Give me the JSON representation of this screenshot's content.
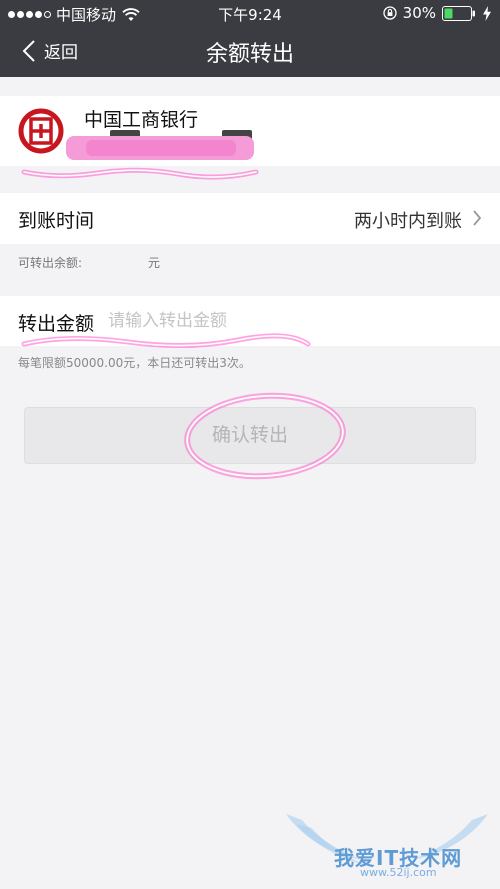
{
  "status_bar": {
    "carrier": "中国移动",
    "time": "下午9:24",
    "battery": "30%",
    "icons": [
      "signal-dots",
      "wifi-icon",
      "orientation-lock-icon",
      "battery-icon",
      "charging-icon"
    ]
  },
  "nav": {
    "back_label": "返回",
    "title": "余额转出"
  },
  "bank": {
    "name": "中国工商银行",
    "logo": "icbc-logo-icon"
  },
  "arrival": {
    "label": "到账时间",
    "value": "两小时内到账"
  },
  "balance": {
    "label": "可转出余额:",
    "unit": "元"
  },
  "amount": {
    "label": "转出金额",
    "placeholder": "请输入转出金额"
  },
  "limit_note": "每笔限额50000.00元，本日还可转出3次。",
  "confirm_label": "确认转出",
  "watermark": {
    "text": "我爱IT技术网",
    "sub": "www.52ij.com"
  },
  "colors": {
    "header_bg": "#3b3c41",
    "page_bg": "#f3f3f5",
    "bank_red": "#c8161e",
    "annotation_pink": "#ff5ac8",
    "battery_green": "#4cd964"
  }
}
